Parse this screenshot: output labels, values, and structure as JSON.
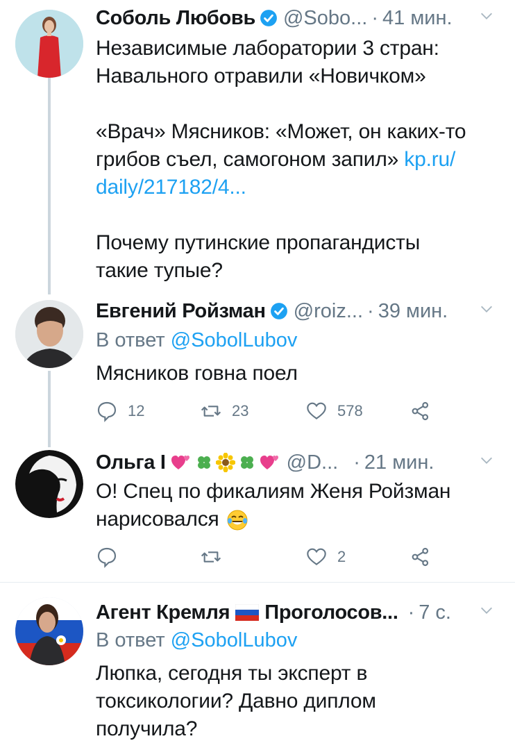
{
  "tweets": [
    {
      "name": "Соболь Любовь",
      "handle": "@Sobo...",
      "time": "41 мин.",
      "lines": [
        "Независимые лаборатории 3 стран:",
        "Навального отравили «Новичком»",
        "",
        "«Врач» Мясников: «Может, он каких-то",
        "грибов съел, самогоном запил»",
        "daily/217182/4...",
        "",
        "Почему путинские пропагандисты",
        "такие тупые?"
      ],
      "link_part1": "kp.ru/",
      "link_part2": "daily/217182/4..."
    },
    {
      "name": "Евгений Ройзман",
      "handle": "@roiz...",
      "time": "39 мин.",
      "reply_prefix": "В ответ",
      "reply_to": "@SobolLubov",
      "text": "Мясников говна поел",
      "replies": "12",
      "retweets": "23",
      "likes": "578"
    },
    {
      "name": "Ольга I",
      "handle": "@D...",
      "time": "21 мин.",
      "line1": "О! Спец по фикалиям Женя Ройзман",
      "line2": "нарисовался",
      "replies": "",
      "retweets": "",
      "likes": "2"
    },
    {
      "name": "Агент Кремля",
      "name_suffix": "Проголосов...",
      "time": "7 с.",
      "reply_prefix": "В ответ",
      "reply_to": "@SobolLubov",
      "lines": [
        "Люпка, сегодня ты эксперт в",
        "токсикологии? Давно диплом",
        "получила?"
      ]
    }
  ],
  "sep": "·",
  "colors": {
    "accent": "#1da1f2",
    "muted": "#657786",
    "divider": "#e6ecf0",
    "thread": "#ccd6dd"
  }
}
